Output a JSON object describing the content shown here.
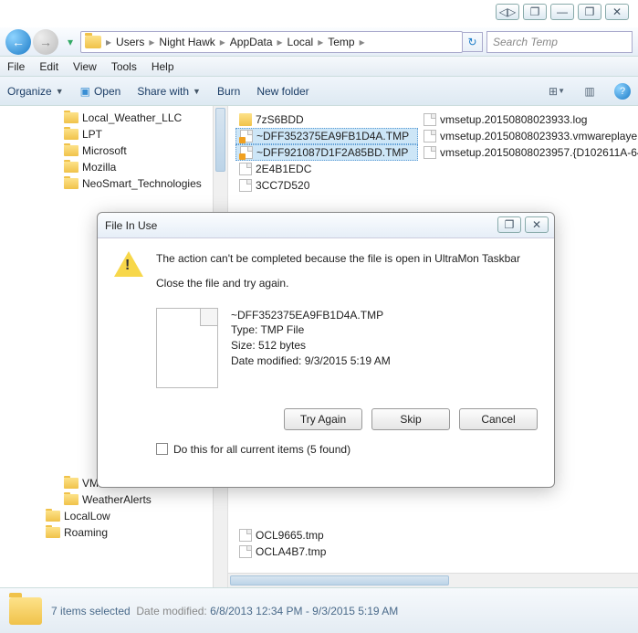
{
  "sysbtns": [
    "◁▷",
    "❐",
    "—",
    "❐",
    "✕"
  ],
  "breadcrumb": [
    "Users",
    "Night Hawk",
    "AppData",
    "Local",
    "Temp"
  ],
  "search_placeholder": "Search Temp",
  "menu": [
    "File",
    "Edit",
    "View",
    "Tools",
    "Help"
  ],
  "toolbar": {
    "organize": "Organize",
    "open": "Open",
    "share": "Share with",
    "burn": "Burn",
    "newfolder": "New folder"
  },
  "tree": {
    "items": [
      "Local_Weather_LLC",
      "LPT",
      "Microsoft",
      "Mozilla",
      "NeoSmart_Technologies"
    ],
    "items_bottom": [
      "VMware",
      "WeatherAlerts"
    ],
    "level1": [
      "LocalLow",
      "Roaming"
    ]
  },
  "files_col1": [
    {
      "name": "7zS6BDD",
      "type": "folder",
      "sel": false
    },
    {
      "name": "~DFF352375EA9FB1D4A.TMP",
      "type": "file",
      "sel": true,
      "lock": true
    },
    {
      "name": "~DFF921087D1F2A85BD.TMP",
      "type": "file",
      "sel": true,
      "lock": true
    },
    {
      "name": "2E4B1EDC",
      "type": "file",
      "sel": false
    },
    {
      "name": "3CC7D520",
      "type": "file",
      "sel": false
    }
  ],
  "files_col2": [
    {
      "name": "vmsetup.20150808023933.log"
    },
    {
      "name": "vmsetup.20150808023933.vmwareplaye"
    },
    {
      "name": "vmsetup.20150808023957.{D102611A-64"
    }
  ],
  "files_bottom": [
    {
      "name": "OCL9665.tmp"
    },
    {
      "name": "OCLA4B7.tmp"
    }
  ],
  "status": {
    "count": "7 items selected",
    "datelabel": "Date modified:",
    "daterange": "6/8/2013 12:34 PM - 9/3/2015 5:19 AM"
  },
  "dialog": {
    "title": "File In Use",
    "msg1": "The action can't be completed because the file is open in UltraMon Taskbar",
    "msg2": "Close the file and try again.",
    "filename": "~DFF352375EA9FB1D4A.TMP",
    "type": "Type: TMP File",
    "size": "Size: 512 bytes",
    "modified": "Date modified: 9/3/2015 5:19 AM",
    "tryagain": "Try Again",
    "skip": "Skip",
    "cancel": "Cancel",
    "check": "Do this for all current items (5 found)"
  }
}
